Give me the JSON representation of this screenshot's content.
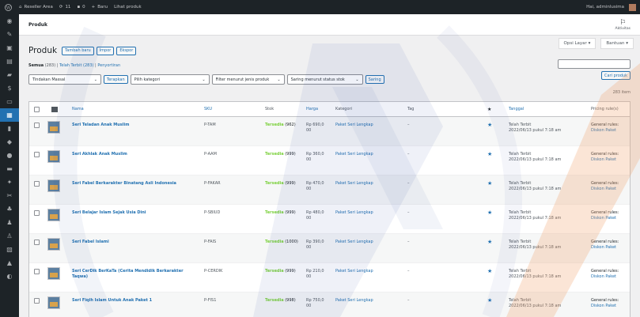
{
  "adminbar": {
    "site_name": "Reseller Area",
    "updates": "11",
    "comments": "0",
    "new_label": "Baru",
    "view_products": "Lihat produk",
    "greeting": "Hai, adminlusima"
  },
  "topbar": {
    "page": "Produk",
    "activity": "Aktivitas"
  },
  "screen_options": {
    "screen": "Opsi Layar",
    "help": "Bantuan"
  },
  "heading": {
    "title": "Produk",
    "add_new": "Tambah baru",
    "import": "Impor",
    "export": "Ekspor"
  },
  "views": {
    "all": "Semua",
    "all_count": "(283)",
    "published": "Telah Terbit (283)",
    "sorting": "Penyortiran"
  },
  "search": {
    "placeholder": "",
    "button": "Cari produk"
  },
  "items_count": "283 item",
  "filters": {
    "bulk": "Tindakan Massal",
    "apply": "Terapkan",
    "category": "Pilih kategori",
    "type": "Filter menurut jenis produk",
    "stock": "Saring menurut status stok",
    "filter_btn": "Saring"
  },
  "columns": {
    "name": "Nama",
    "sku": "SKU",
    "stock": "Stok",
    "price": "Harga",
    "category": "Kategori",
    "tag": "Tag",
    "featured": "★",
    "date": "Tanggal",
    "pricing": "Pricing rule(s)"
  },
  "rows": [
    {
      "name": "Seri Teladan Anak Muslim",
      "sku": "P-TAM",
      "stock_status": "Tersedia",
      "stock_qty": "(962)",
      "price": "Rp 690,0",
      "price2": "00",
      "category": "Paket Seri Lengkap",
      "tag": "–",
      "date_status": "Telah Terbit",
      "date": "2022/06/13 pukul 7:18 am",
      "rule_label": "General rules:",
      "rule": "Diskon Paket"
    },
    {
      "name": "Seri Akhlak Anak Muslim",
      "sku": "P-AAM",
      "stock_status": "Tersedia",
      "stock_qty": "(999)",
      "price": "Rp 360,0",
      "price2": "00",
      "category": "Paket Seri Lengkap",
      "tag": "–",
      "date_status": "Telah Terbit",
      "date": "2022/06/13 pukul 7:18 am",
      "rule_label": "General rules:",
      "rule": "Diskon Paket"
    },
    {
      "name": "Seri Fabel Berkarakter Binatang Asli Indonesia",
      "sku": "P-FAKAR",
      "stock_status": "Tersedia",
      "stock_qty": "(999)",
      "price": "Rp 470,0",
      "price2": "00",
      "category": "Paket Seri Lengkap",
      "tag": "–",
      "date_status": "Telah Terbit",
      "date": "2022/06/13 pukul 7:18 am",
      "rule_label": "General rules:",
      "rule": "Diskon Paket"
    },
    {
      "name": "Seri Belajar Islam Sejak Usia Dini",
      "sku": "P-SBIUD",
      "stock_status": "Tersedia",
      "stock_qty": "(999)",
      "price": "Rp 480,0",
      "price2": "00",
      "category": "Paket Seri Lengkap",
      "tag": "–",
      "date_status": "Telah Terbit",
      "date": "2022/06/13 pukul 7:18 am",
      "rule_label": "General rules:",
      "rule": "Diskon Paket"
    },
    {
      "name": "Seri Fabel Islami",
      "sku": "P-FAIS",
      "stock_status": "Tersedia",
      "stock_qty": "(1000)",
      "price": "Rp 390,0",
      "price2": "00",
      "category": "Paket Seri Lengkap",
      "tag": "–",
      "date_status": "Telah Terbit",
      "date": "2022/06/13 pukul 7:18 am",
      "rule_label": "General rules:",
      "rule": "Diskon Paket"
    },
    {
      "name": "Seri CerDik BerKaTa (Cerita Mendidik Berkarakter Taqwa)",
      "sku": "P-CERDIK",
      "stock_status": "Tersedia",
      "stock_qty": "(999)",
      "price": "Rp 210,0",
      "price2": "00",
      "category": "Paket Seri Lengkap",
      "tag": "–",
      "date_status": "Telah Terbit",
      "date": "2022/06/13 pukul 7:18 am",
      "rule_label": "General rules:",
      "rule": "Diskon Paket"
    },
    {
      "name": "Seri Fiqih Islam Untuk Anak Paket 1",
      "sku": "P-FIS1",
      "stock_status": "Tersedia",
      "stock_qty": "(998)",
      "price": "Rp 750,0",
      "price2": "00",
      "category": "Paket Seri Lengkap",
      "tag": "–",
      "date_status": "Telah Terbit",
      "date": "2022/06/13 pukul 7:18 am",
      "rule_label": "General rules:",
      "rule": "Diskon Paket"
    }
  ],
  "colors": {
    "accent": "#2271b1",
    "instock": "#7ad03a",
    "adminbar": "#1d2327",
    "watermark_blue": "#1e3f9a",
    "watermark_orange": "#f2a06a"
  }
}
